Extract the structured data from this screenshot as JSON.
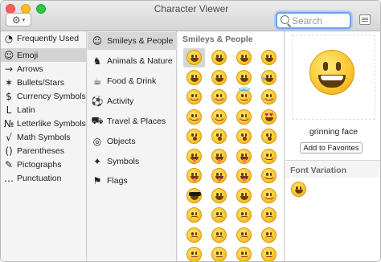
{
  "window": {
    "title": "Character Viewer"
  },
  "toolbar": {
    "gear_icon": "gear-icon",
    "search_placeholder": "Search"
  },
  "sidebar": {
    "items": [
      {
        "label": "Frequently Used",
        "icon": "clock-icon",
        "glyph": "◔"
      },
      {
        "label": "Emoji",
        "icon": "smiley-icon",
        "glyph": "☺",
        "selected": true
      },
      {
        "label": "Arrows",
        "icon": "arrow-icon",
        "glyph": "→"
      },
      {
        "label": "Bullets/Stars",
        "icon": "star-icon",
        "glyph": "✶"
      },
      {
        "label": "Currency Symbols",
        "icon": "dollar-icon",
        "glyph": "$"
      },
      {
        "label": "Latin",
        "icon": "latin-icon",
        "glyph": "L"
      },
      {
        "label": "Letterlike Symbols",
        "icon": "numero-icon",
        "glyph": "№"
      },
      {
        "label": "Math Symbols",
        "icon": "check-icon",
        "glyph": "√"
      },
      {
        "label": "Parentheses",
        "icon": "parentheses-icon",
        "glyph": "()"
      },
      {
        "label": "Pictographs",
        "icon": "pictograph-icon",
        "glyph": "✎"
      },
      {
        "label": "Punctuation",
        "icon": "punctuation-icon",
        "glyph": "…"
      }
    ]
  },
  "categories": {
    "items": [
      {
        "label": "Smileys & People",
        "icon": "smiley-icon",
        "glyph": "☺",
        "selected": true
      },
      {
        "label": "Animals & Nature",
        "icon": "bear-icon",
        "glyph": "♞"
      },
      {
        "label": "Food & Drink",
        "icon": "food-icon",
        "glyph": "☕"
      },
      {
        "label": "Activity",
        "icon": "ball-icon",
        "glyph": "⚽"
      },
      {
        "label": "Travel & Places",
        "icon": "car-icon",
        "glyph": "⛟"
      },
      {
        "label": "Objects",
        "icon": "bulb-icon",
        "glyph": "◎"
      },
      {
        "label": "Symbols",
        "icon": "symbols-icon",
        "glyph": "✦"
      },
      {
        "label": "Flags",
        "icon": "flag-icon",
        "glyph": "⚑"
      }
    ]
  },
  "grid": {
    "heading": "Smileys & People",
    "selected_index": 0
  },
  "detail": {
    "character_name": "grinning face",
    "add_favorites_label": "Add to Favorites",
    "font_variation_heading": "Font Variation"
  },
  "colors": {
    "emoji_yellow": "#fcc630",
    "search_focus": "#6fa1ec",
    "selection": "#d3d3d3"
  }
}
